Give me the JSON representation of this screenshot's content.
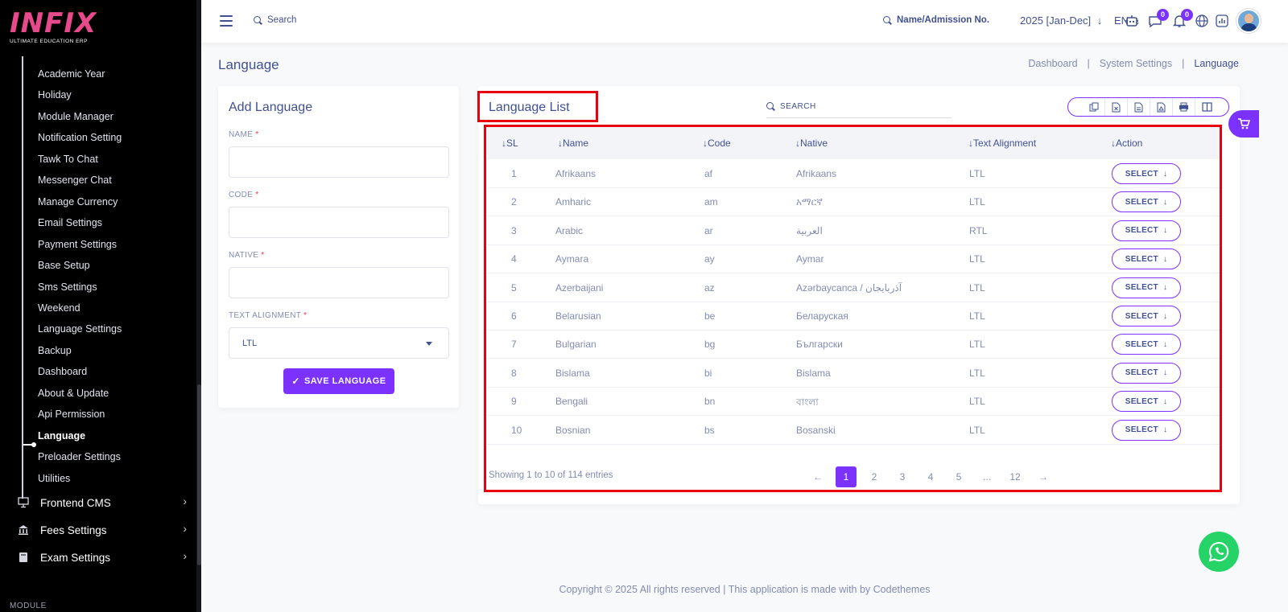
{
  "brand": {
    "logo_main": "INFIX",
    "logo_sub": "ULTIMATE EDUCATION ERP"
  },
  "sidebar": {
    "sub_items": [
      "Academic Year",
      "Holiday",
      "Module Manager",
      "Notification Setting",
      "Tawk To Chat",
      "Messenger Chat",
      "Manage Currency",
      "Email Settings",
      "Payment Settings",
      "Base Setup",
      "Sms Settings",
      "Weekend",
      "Language Settings",
      "Backup",
      "Dashboard",
      "About & Update",
      "Api Permission",
      "Language",
      "Preloader Settings",
      "Utilities"
    ],
    "active_item": "Language",
    "nav_items": [
      {
        "label": "Frontend CMS",
        "icon": "monitor-icon"
      },
      {
        "label": "Fees Settings",
        "icon": "bank-icon"
      },
      {
        "label": "Exam Settings",
        "icon": "book-icon"
      }
    ],
    "module_label": "MODULE"
  },
  "topbar": {
    "search_placeholder": "Search",
    "student_search_placeholder": "Name/Admission No.",
    "session": "2025 [Jan-Dec]",
    "language": "EN",
    "chat_count": "0",
    "notification_count": "0"
  },
  "page": {
    "title": "Language",
    "breadcrumb": [
      "Dashboard",
      "System Settings",
      "Language"
    ]
  },
  "form": {
    "title": "Add Language",
    "name_label": "NAME",
    "code_label": "CODE",
    "native_label": "NATIVE",
    "alignment_label": "TEXT ALIGNMENT",
    "required_mark": "*",
    "alignment_value": "LTL",
    "save_label": "SAVE LANGUAGE"
  },
  "list": {
    "title": "Language List",
    "search_placeholder": "SEARCH",
    "export_icons": [
      "copy-icon",
      "excel-icon",
      "csv-icon",
      "pdf-icon",
      "print-icon",
      "columns-icon"
    ],
    "columns": [
      "SL",
      "Name",
      "Code",
      "Native",
      "Text Alignment",
      "Action"
    ],
    "rows": [
      {
        "sl": "1",
        "name": "Afrikaans",
        "code": "af",
        "native": "Afrikaans",
        "align": "LTL",
        "action": "SELECT"
      },
      {
        "sl": "2",
        "name": "Amharic",
        "code": "am",
        "native": "አማርኛ",
        "align": "LTL",
        "action": "SELECT"
      },
      {
        "sl": "3",
        "name": "Arabic",
        "code": "ar",
        "native": "العربية",
        "align": "RTL",
        "action": "SELECT"
      },
      {
        "sl": "4",
        "name": "Aymara",
        "code": "ay",
        "native": "Aymar",
        "align": "LTL",
        "action": "SELECT"
      },
      {
        "sl": "5",
        "name": "Azerbaijani",
        "code": "az",
        "native": "Azərbaycanca / آذربايجان",
        "align": "LTL",
        "action": "SELECT"
      },
      {
        "sl": "6",
        "name": "Belarusian",
        "code": "be",
        "native": "Беларуская",
        "align": "LTL",
        "action": "SELECT"
      },
      {
        "sl": "7",
        "name": "Bulgarian",
        "code": "bg",
        "native": "Български",
        "align": "LTL",
        "action": "SELECT"
      },
      {
        "sl": "8",
        "name": "Bislama",
        "code": "bi",
        "native": "Bislama",
        "align": "LTL",
        "action": "SELECT"
      },
      {
        "sl": "9",
        "name": "Bengali",
        "code": "bn",
        "native": "বাংলা",
        "align": "LTL",
        "action": "SELECT"
      },
      {
        "sl": "10",
        "name": "Bosnian",
        "code": "bs",
        "native": "Bosanski",
        "align": "LTL",
        "action": "SELECT"
      }
    ],
    "showing_text": "Showing 1 to 10 of 114 entries",
    "pages": [
      "1",
      "2",
      "3",
      "4",
      "5",
      "...",
      "12"
    ],
    "active_page": "1"
  },
  "footer": {
    "text": "Copyright © 2025 All rights reserved | This application is made with by Codethemes"
  },
  "colors": {
    "accent": "#7c32ff",
    "text": "#415094",
    "muted": "#828bb2",
    "highlight": "#e8000f",
    "whatsapp": "#25d366"
  }
}
